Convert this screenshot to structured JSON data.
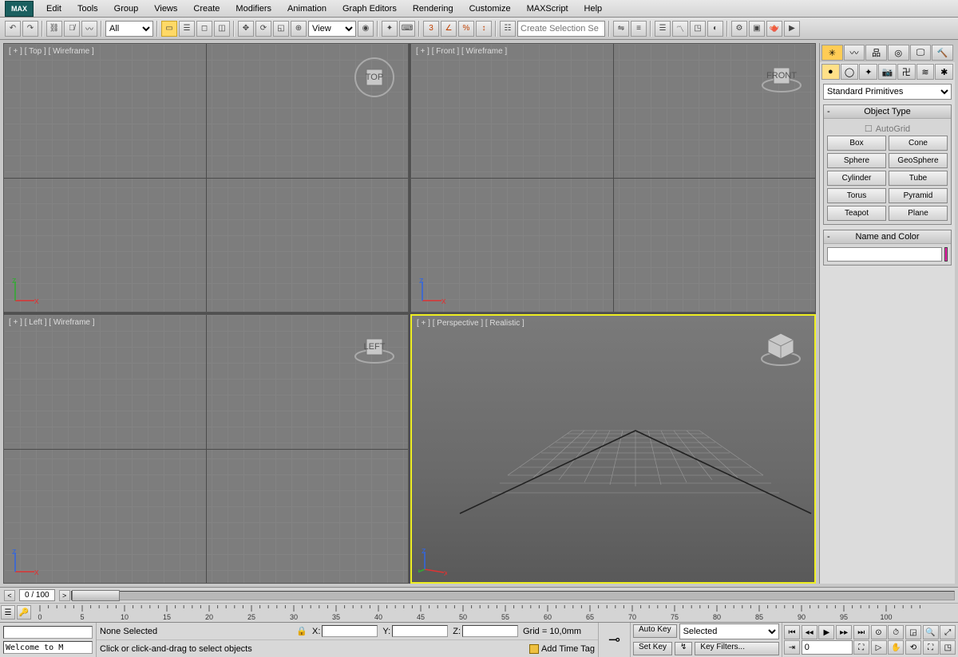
{
  "app_logo": "MAX",
  "menu": [
    "Edit",
    "Tools",
    "Group",
    "Views",
    "Create",
    "Modifiers",
    "Animation",
    "Graph Editors",
    "Rendering",
    "Customize",
    "MAXScript",
    "Help"
  ],
  "toolbar": {
    "filter_selected": "All",
    "view_selected": "View",
    "selection_set_placeholder": "Create Selection Se"
  },
  "viewports": {
    "top": {
      "label": "[ + ] [ Top ] [ Wireframe ]",
      "cube": "TOP"
    },
    "front": {
      "label": "[ + ] [ Front ] [ Wireframe ]",
      "cube": "FRONT"
    },
    "left": {
      "label": "[ + ] [ Left ] [ Wireframe ]",
      "cube": "LEFT"
    },
    "persp": {
      "label": "[ + ] [ Perspective ] [ Realistic ]",
      "cube": ""
    }
  },
  "panel": {
    "category_selected": "Standard Primitives",
    "object_type_header": "Object Type",
    "autogrid": "AutoGrid",
    "primitives": [
      "Box",
      "Cone",
      "Sphere",
      "GeoSphere",
      "Cylinder",
      "Tube",
      "Torus",
      "Pyramid",
      "Teapot",
      "Plane"
    ],
    "name_color_header": "Name and Color"
  },
  "timeline": {
    "frame_label": "0 / 100",
    "ticks": [
      0,
      5,
      10,
      15,
      20,
      25,
      30,
      35,
      40,
      45,
      50,
      55,
      60,
      65,
      70,
      75,
      80,
      85,
      90,
      95,
      100
    ]
  },
  "status": {
    "welcome": "Welcome to M",
    "none_selected": "None Selected",
    "prompt": "Click or click-and-drag to select objects",
    "x_label": "X:",
    "y_label": "Y:",
    "z_label": "Z:",
    "grid_label": "Grid = 10,0mm",
    "add_time_tag": "Add Time Tag",
    "auto_key": "Auto Key",
    "set_key": "Set Key",
    "selected": "Selected",
    "key_filters": "Key Filters...",
    "frame_field": "0"
  }
}
